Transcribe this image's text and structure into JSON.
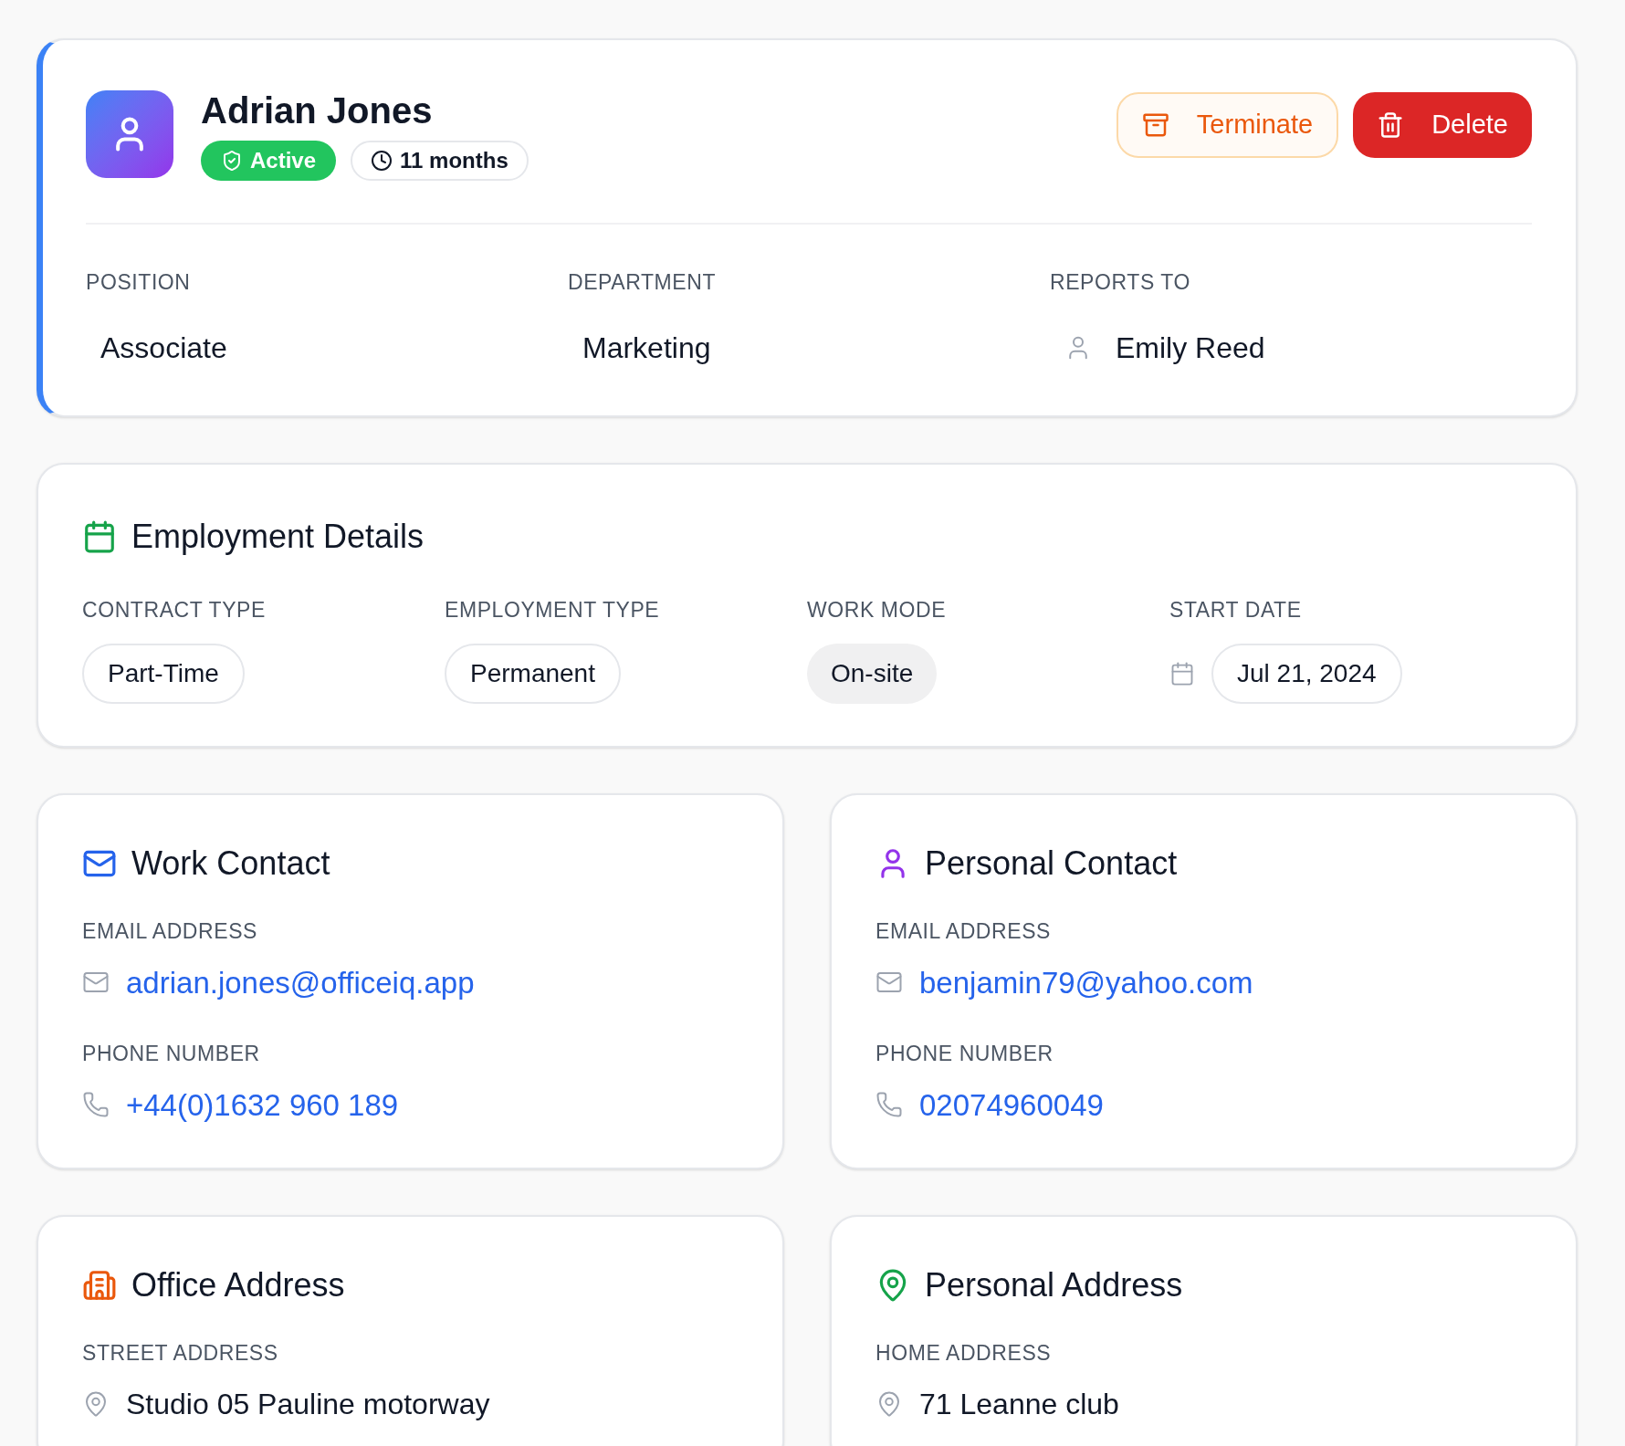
{
  "profile": {
    "name": "Adrian Jones",
    "status": "Active",
    "tenure": "11 months",
    "actions": [
      {
        "label": "Terminate",
        "kind": "outline"
      },
      {
        "label": "Delete",
        "kind": "danger"
      }
    ],
    "fields": [
      {
        "label": "POSITION",
        "value": "Associate",
        "kind": "plain"
      },
      {
        "label": "DEPARTMENT",
        "value": "Marketing",
        "kind": "plain"
      },
      {
        "label": "REPORTS TO",
        "value": "Emily Reed",
        "kind": "person"
      }
    ]
  },
  "employment": {
    "title": "Employment Details",
    "fields": [
      {
        "label": "CONTRACT TYPE",
        "value": "Part-Time",
        "kind": "outline"
      },
      {
        "label": "EMPLOYMENT TYPE",
        "value": "Permanent",
        "kind": "outline"
      },
      {
        "label": "WORK MODE",
        "value": "On-site",
        "kind": "filled"
      },
      {
        "label": "START DATE",
        "value": "Jul 21, 2024",
        "kind": "date"
      }
    ]
  },
  "cards": [
    {
      "title": "Work Contact",
      "kind": "mail",
      "fields": [
        {
          "label": "EMAIL ADDRESS",
          "value": "adrian.jones@officeiq.app",
          "kind": "email"
        },
        {
          "label": "PHONE NUMBER",
          "value": "+44(0)1632 960 189",
          "kind": "phone"
        }
      ]
    },
    {
      "title": "Personal Contact",
      "kind": "person",
      "fields": [
        {
          "label": "EMAIL ADDRESS",
          "value": "benjamin79@yahoo.com",
          "kind": "email"
        },
        {
          "label": "PHONE NUMBER",
          "value": "02074960049",
          "kind": "phone"
        }
      ]
    },
    {
      "title": "Office Address",
      "kind": "building",
      "fields": [
        {
          "label": "STREET ADDRESS",
          "value": "Studio 05 Pauline motorway",
          "kind": "address"
        }
      ]
    },
    {
      "title": "Personal Address",
      "kind": "pin",
      "fields": [
        {
          "label": "HOME ADDRESS",
          "value": "71 Leanne club",
          "kind": "address"
        }
      ]
    }
  ]
}
